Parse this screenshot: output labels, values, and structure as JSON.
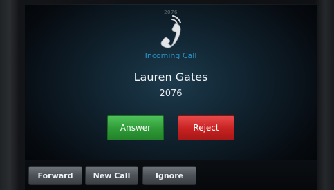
{
  "status_bar": {
    "text": "2076"
  },
  "call": {
    "icon": "handset-icon",
    "status_label": "Incoming Call",
    "caller_name": "Lauren Gates",
    "caller_number": "2076"
  },
  "actions": {
    "answer_label": "Answer",
    "reject_label": "Reject"
  },
  "softkeys": [
    {
      "label": "Forward"
    },
    {
      "label": "New Call"
    },
    {
      "label": "Ignore"
    }
  ],
  "colors": {
    "status_label": "#2a93c9",
    "answer": "#2e9a36",
    "reject": "#c72121",
    "softkey": "#4d5258"
  }
}
